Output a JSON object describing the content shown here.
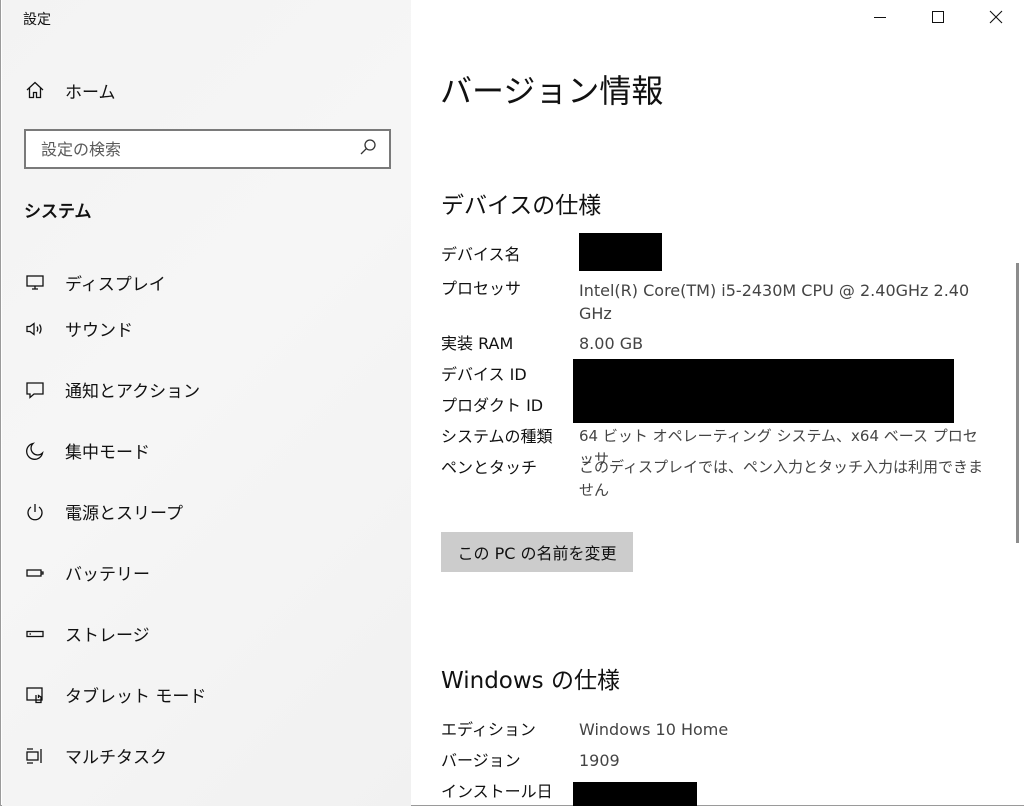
{
  "window": {
    "title": "設定"
  },
  "sidebar": {
    "home_label": "ホーム",
    "search_placeholder": "設定の検索",
    "section_heading": "システム",
    "items": [
      {
        "label": "ディスプレイ",
        "icon": "monitor-icon"
      },
      {
        "label": "サウンド",
        "icon": "speaker-icon"
      },
      {
        "label": "通知とアクション",
        "icon": "notification-icon"
      },
      {
        "label": "集中モード",
        "icon": "moon-icon"
      },
      {
        "label": "電源とスリープ",
        "icon": "power-icon"
      },
      {
        "label": "バッテリー",
        "icon": "battery-icon"
      },
      {
        "label": "ストレージ",
        "icon": "storage-icon"
      },
      {
        "label": "タブレット モード",
        "icon": "tablet-mode-icon"
      },
      {
        "label": "マルチタスク",
        "icon": "multitask-icon"
      }
    ]
  },
  "main": {
    "page_title": "バージョン情報",
    "device_specs": {
      "heading": "デバイスの仕様",
      "rows": [
        {
          "label": "デバイス名",
          "value": ""
        },
        {
          "label": "プロセッサ",
          "value": "Intel(R) Core(TM) i5-2430M CPU @ 2.40GHz   2.40 GHz"
        },
        {
          "label": "実装 RAM",
          "value": "8.00 GB"
        },
        {
          "label": "デバイス ID",
          "value": ""
        },
        {
          "label": "プロダクト ID",
          "value": ""
        },
        {
          "label": "システムの種類",
          "value": "64 ビット オペレーティング システム、x64 ベース プロセッサ"
        },
        {
          "label": "ペンとタッチ",
          "value": "このディスプレイでは、ペン入力とタッチ入力は利用できません"
        }
      ]
    },
    "rename_button": "この PC の名前を変更",
    "windows_specs": {
      "heading": "Windows の仕様",
      "rows": [
        {
          "label": "エディション",
          "value": "Windows 10 Home"
        },
        {
          "label": "バージョン",
          "value": "1909"
        },
        {
          "label": "インストール日",
          "value": ""
        }
      ]
    }
  },
  "colors": {
    "sidebar_bg": "#f3f3f3",
    "main_bg": "#ffffff",
    "button_bg": "#cccccc",
    "redaction": "#000000"
  }
}
